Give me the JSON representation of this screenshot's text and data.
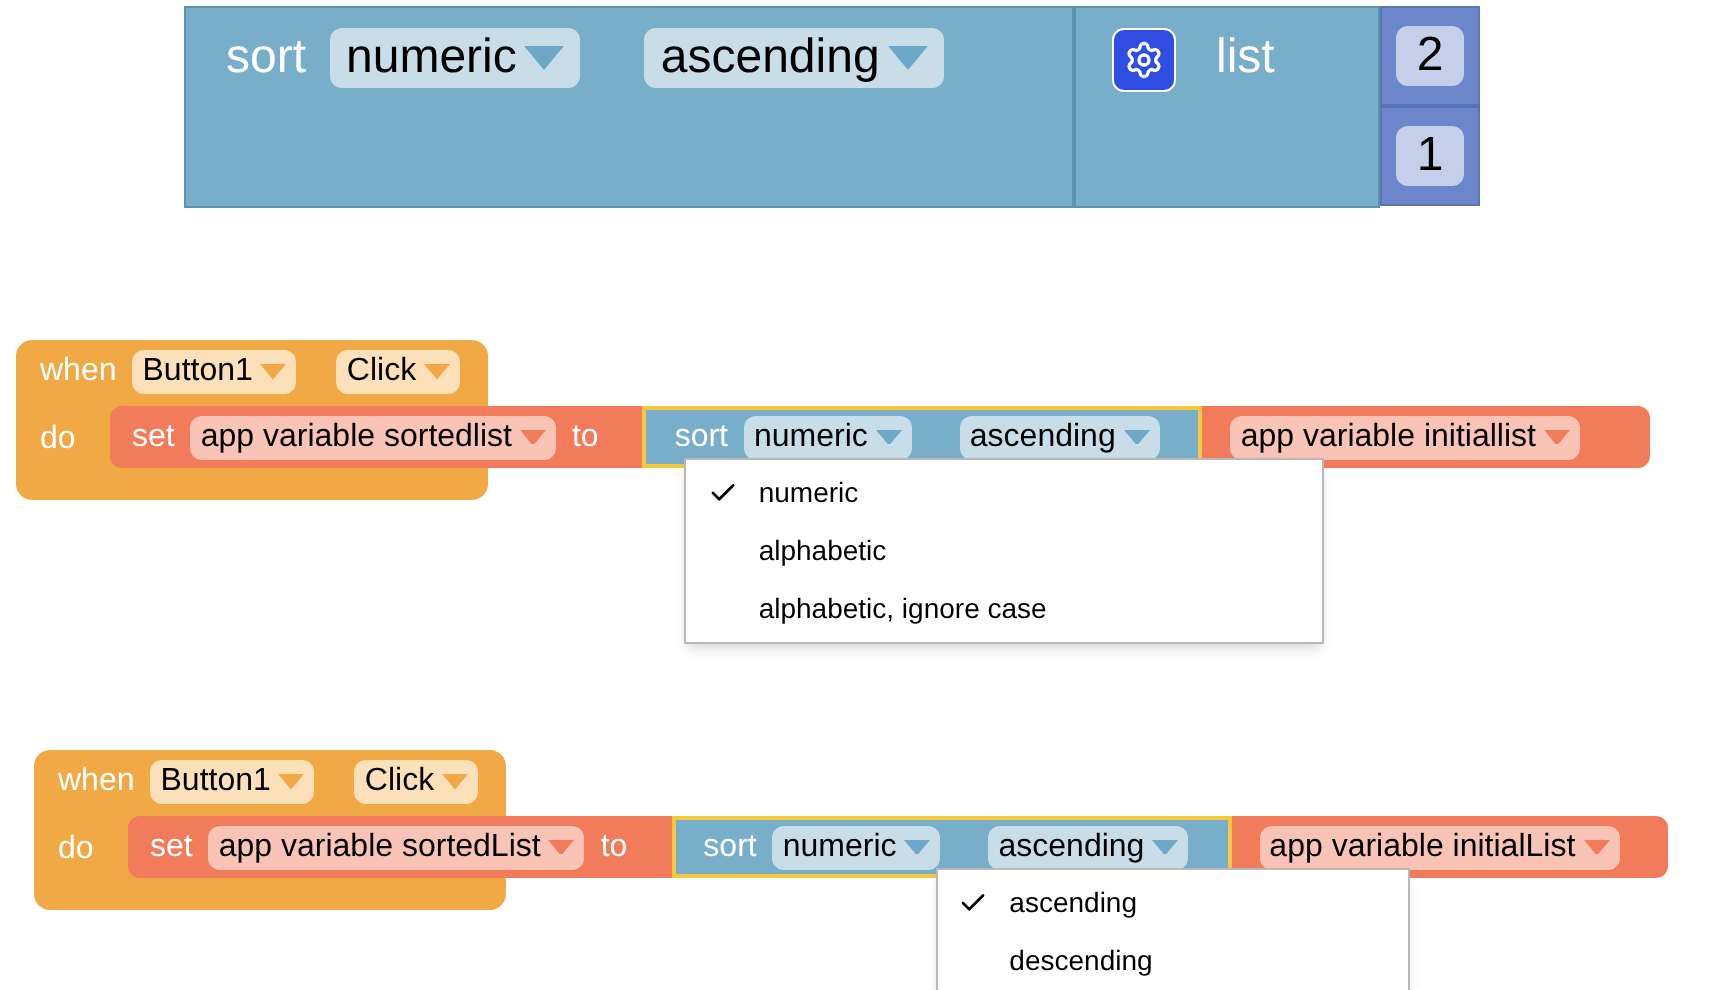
{
  "top_block": {
    "keyword": "sort",
    "order_by": "numeric",
    "direction": "ascending",
    "list_block": {
      "label": "list",
      "items": [
        "2",
        "1"
      ]
    }
  },
  "examples": [
    {
      "event": {
        "keyword": "when",
        "component": "Button1",
        "event": "Click"
      },
      "do_label": "do",
      "set_block": {
        "keyword": "set",
        "variable": "app variable sortedlist",
        "to_label": "to"
      },
      "sort_block": {
        "keyword": "sort",
        "order_by": "numeric",
        "direction": "ascending",
        "selected": true
      },
      "value_block": {
        "variable": "app variable initiallist"
      },
      "menu": {
        "kind": "order",
        "options": [
          {
            "label": "numeric",
            "selected": true
          },
          {
            "label": "alphabetic",
            "selected": false
          },
          {
            "label": "alphabetic, ignore case",
            "selected": false
          }
        ]
      }
    },
    {
      "event": {
        "keyword": "when",
        "component": "Button1",
        "event": "Click"
      },
      "do_label": "do",
      "set_block": {
        "keyword": "set",
        "variable": "app variable sortedList",
        "to_label": "to"
      },
      "sort_block": {
        "keyword": "sort",
        "order_by": "numeric",
        "direction": "ascending",
        "selected": true
      },
      "value_block": {
        "variable": "app variable initialList"
      },
      "menu": {
        "kind": "direction",
        "options": [
          {
            "label": "ascending",
            "selected": true
          },
          {
            "label": "descending",
            "selected": false
          }
        ]
      }
    }
  ]
}
